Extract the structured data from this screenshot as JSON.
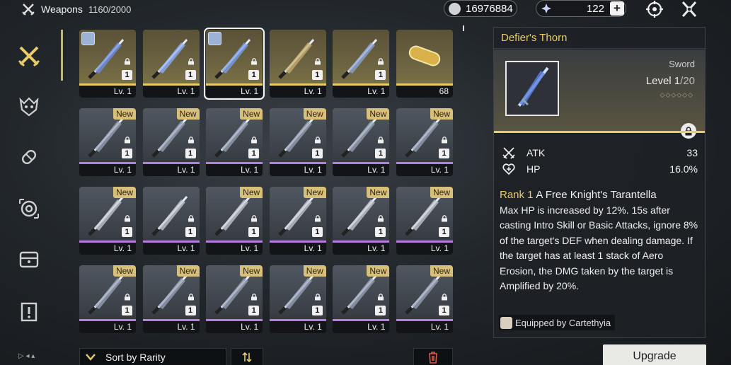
{
  "header": {
    "title": "Weapons",
    "count": "1160/2000",
    "currency_primary": "16976884",
    "currency_secondary": "122"
  },
  "colors": {
    "accent_gold": "#e8cc6a",
    "rarity_gold": "#e8cc6a",
    "rarity_purple": "#b77de0"
  },
  "sidebar": {
    "items": [
      {
        "icon": "weapon-swords-icon",
        "active": true
      },
      {
        "icon": "echo-demon-icon",
        "active": false
      },
      {
        "icon": "material-capsule-icon",
        "active": false
      },
      {
        "icon": "target-icon",
        "active": false
      },
      {
        "icon": "inventory-box-icon",
        "active": false
      },
      {
        "icon": "notice-icon",
        "active": false
      }
    ]
  },
  "grid": {
    "cards": [
      {
        "level": "Lv. 1",
        "rank": "1",
        "rarity": "gold",
        "locked": true,
        "new": false,
        "equipped_avatar": true,
        "selected": false
      },
      {
        "level": "Lv. 1",
        "rank": "1",
        "rarity": "gold",
        "locked": true,
        "new": false,
        "equipped_avatar": false,
        "selected": false
      },
      {
        "level": "Lv. 1",
        "rank": "1",
        "rarity": "gold",
        "locked": true,
        "new": false,
        "equipped_avatar": true,
        "selected": true
      },
      {
        "level": "Lv. 1",
        "rank": "1",
        "rarity": "gold",
        "locked": true,
        "new": false,
        "equipped_avatar": false,
        "selected": false
      },
      {
        "level": "Lv. 1",
        "rank": "1",
        "rarity": "gold",
        "locked": true,
        "new": false,
        "equipped_avatar": false,
        "selected": false
      },
      {
        "level": "68",
        "rank": "",
        "rarity": "gold",
        "locked": false,
        "new": false,
        "equipped_avatar": false,
        "selected": false
      },
      {
        "level": "Lv. 1",
        "rank": "1",
        "rarity": "purple",
        "locked": true,
        "new": true
      },
      {
        "level": "Lv. 1",
        "rank": "1",
        "rarity": "purple",
        "locked": true,
        "new": true
      },
      {
        "level": "Lv. 1",
        "rank": "1",
        "rarity": "purple",
        "locked": true,
        "new": true
      },
      {
        "level": "Lv. 1",
        "rank": "1",
        "rarity": "purple",
        "locked": true,
        "new": true
      },
      {
        "level": "Lv. 1",
        "rank": "1",
        "rarity": "purple",
        "locked": true,
        "new": true
      },
      {
        "level": "Lv. 1",
        "rank": "1",
        "rarity": "purple",
        "locked": true,
        "new": true
      },
      {
        "level": "Lv. 1",
        "rank": "1",
        "rarity": "purple",
        "locked": true,
        "new": true
      },
      {
        "level": "Lv. 1",
        "rank": "1",
        "rarity": "purple",
        "locked": true,
        "new": false
      },
      {
        "level": "Lv. 1",
        "rank": "1",
        "rarity": "purple",
        "locked": true,
        "new": true
      },
      {
        "level": "Lv. 1",
        "rank": "1",
        "rarity": "purple",
        "locked": true,
        "new": true
      },
      {
        "level": "Lv. 1",
        "rank": "1",
        "rarity": "purple",
        "locked": true,
        "new": true
      },
      {
        "level": "Lv. 1",
        "rank": "1",
        "rarity": "purple",
        "locked": true,
        "new": true
      },
      {
        "level": "Lv. 1",
        "rank": "1",
        "rarity": "purple",
        "locked": true,
        "new": true
      },
      {
        "level": "Lv. 1",
        "rank": "1",
        "rarity": "purple",
        "locked": true,
        "new": true
      },
      {
        "level": "Lv. 1",
        "rank": "1",
        "rarity": "purple",
        "locked": true,
        "new": true
      },
      {
        "level": "Lv. 1",
        "rank": "1",
        "rarity": "purple",
        "locked": true,
        "new": true
      },
      {
        "level": "Lv. 1",
        "rank": "1",
        "rarity": "purple",
        "locked": true,
        "new": true
      },
      {
        "level": "Lv. 1",
        "rank": "1",
        "rarity": "purple",
        "locked": true,
        "new": true
      }
    ],
    "new_label": "New"
  },
  "toolbar": {
    "sort_label": "Sort by Rarity"
  },
  "detail": {
    "name": "Defier's Thorn",
    "type": "Sword",
    "level_current": "Level 1",
    "level_max": "/20",
    "stats": [
      {
        "icon": "atk-swords-icon",
        "label": "ATK",
        "value": "33"
      },
      {
        "icon": "hp-heart-icon",
        "label": "HP",
        "value": "16.0%"
      }
    ],
    "passive_rank": "Rank 1",
    "passive_name": "A Free Knight's Tarantella",
    "passive_text": "Max HP is increased by 12%. 15s after casting Intro Skill or Basic Attacks, ignore 8% of the target's DEF when dealing damage. If the target has at least 1 stack of Aero Erosion, the DMG taken by the target is Amplified by 20%.",
    "equipped_by": "Equipped by Cartethyia"
  },
  "actions": {
    "upgrade_label": "Upgrade"
  }
}
